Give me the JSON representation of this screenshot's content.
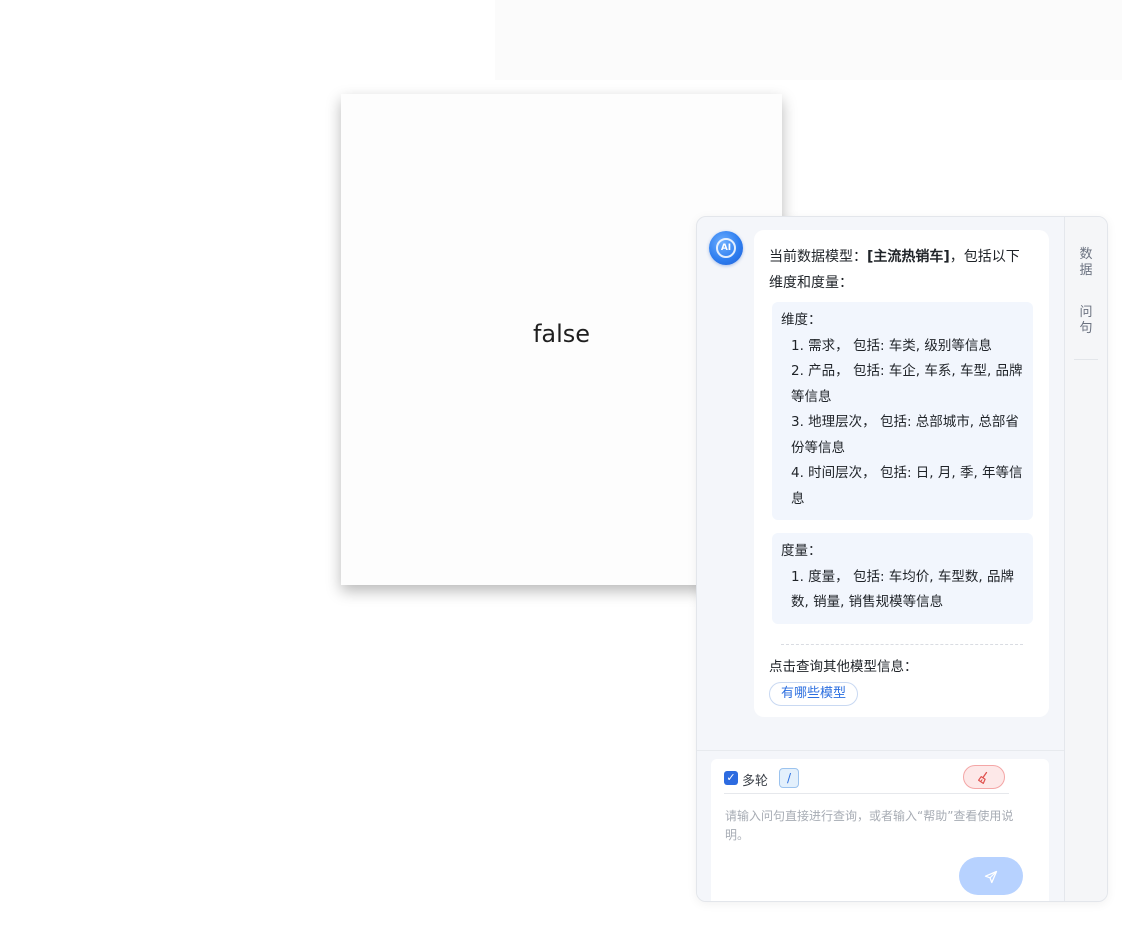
{
  "preview": {
    "text": "false"
  },
  "chat": {
    "avatar_label": "AI",
    "message": {
      "intro_prefix": "当前数据模型：",
      "model_name": "[主流热销车]",
      "intro_suffix": "，包括以下维度和度量：",
      "dimensions": {
        "title": "维度：",
        "items": [
          "1. 需求， 包括: 车类, 级别等信息",
          "2. 产品， 包括: 车企, 车系, 车型, 品牌等信息",
          "3. 地理层次， 包括: 总部城市, 总部省份等信息",
          "4. 时间层次， 包括: 日, 月, 季, 年等信息"
        ]
      },
      "measures": {
        "title": "度量：",
        "items": [
          "1. 度量， 包括: 车均价, 车型数, 品牌数, 销量, 销售规模等信息"
        ]
      },
      "prompt": "点击查询其他模型信息：",
      "suggestion": "有哪些模型"
    },
    "rail_tabs": [
      "数据",
      "问句"
    ],
    "input": {
      "multi_round_label": "多轮",
      "multi_round_checked": true,
      "slash_label": "/",
      "clear_icon": "broom-icon",
      "placeholder": "请输入问句直接进行查询，或者输入“帮助”查看使用说明。",
      "value": "",
      "send_icon": "send-icon"
    }
  },
  "colors": {
    "accent": "#2d6be0",
    "send_disabled": "#b7d2ff",
    "clear_red": "#e0524f",
    "block_bg": "#f2f6fd"
  }
}
